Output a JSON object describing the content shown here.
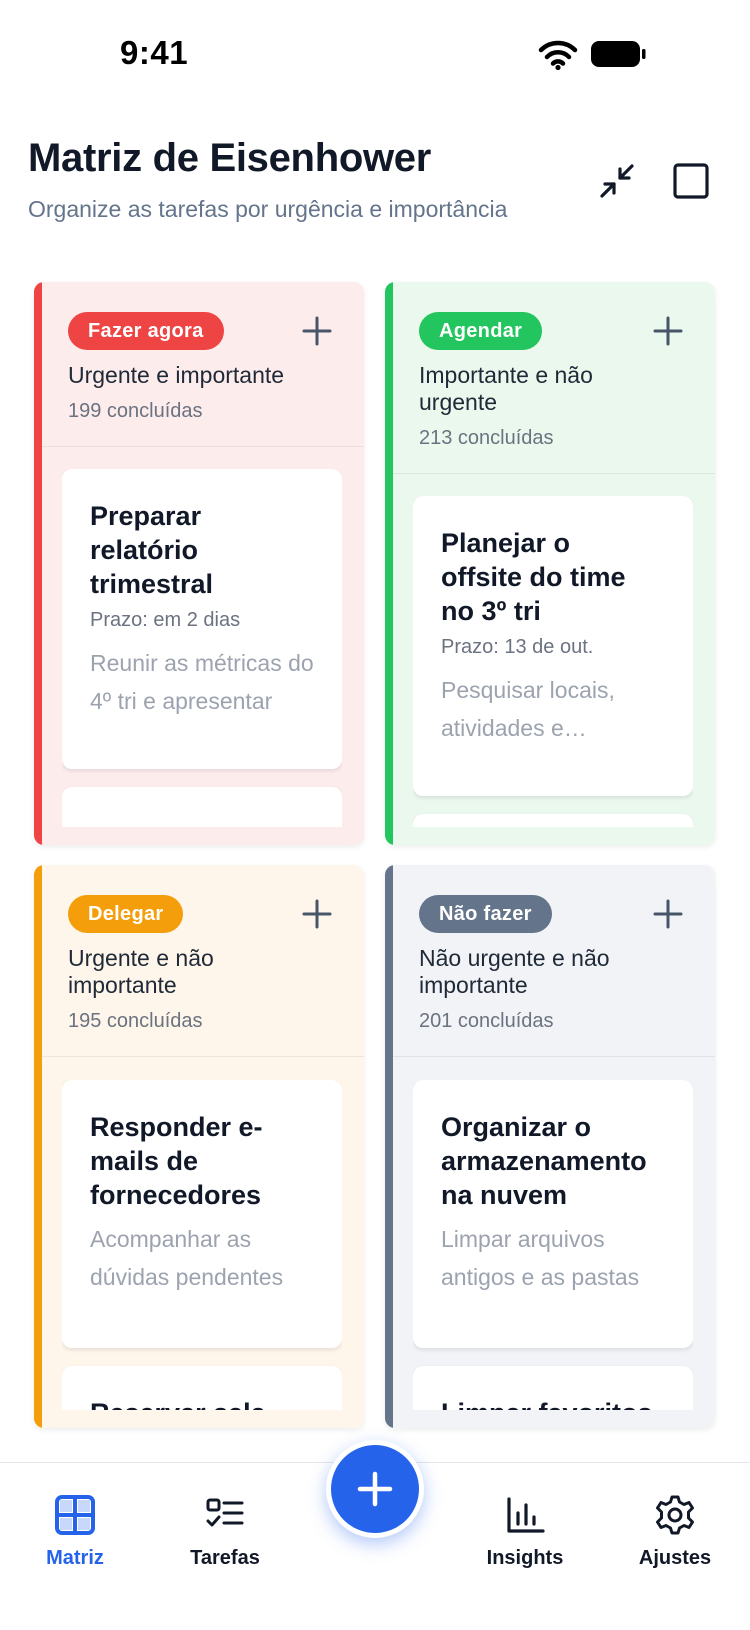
{
  "status_bar": {
    "time": "9:41"
  },
  "header": {
    "title": "Matriz de Eisenhower",
    "subtitle": "Organize as tarefas por urgência e importância"
  },
  "colors": {
    "do_now": "#ef4444",
    "schedule": "#22c55e",
    "delegate": "#f59e0b",
    "dont_do": "#64748b",
    "primary": "#2563eb"
  },
  "quadrants": [
    {
      "badge": "Fazer agora",
      "label": "Urgente e importante",
      "count": "199 concluídas",
      "cards": [
        {
          "title": "Preparar relatório trimestral",
          "due": "Prazo: em 2 dias",
          "desc": "Reunir as métricas do 4º tri e apresentar"
        }
      ]
    },
    {
      "badge": "Agendar",
      "label": "Importante e não urgente",
      "count": "213 concluídas",
      "cards": [
        {
          "title": "Planejar o offsite do time no 3º tri",
          "due": "Prazo: 13 de out.",
          "desc": "Pesquisar locais, atividades e orçamento"
        }
      ]
    },
    {
      "badge": "Delegar",
      "label": "Urgente e não importante",
      "count": "195 concluídas",
      "cards": [
        {
          "title": "Responder e-mails de fornecedores",
          "desc": "Acompanhar as dúvidas pendentes"
        },
        {
          "title": "Reservar sala"
        }
      ]
    },
    {
      "badge": "Não fazer",
      "label": "Não urgente e não importante",
      "count": "201 concluídas",
      "cards": [
        {
          "title": "Organizar o armazenamento na nuvem",
          "desc": "Limpar arquivos antigos e as pastas"
        },
        {
          "title": "Limpar favoritos"
        }
      ]
    }
  ],
  "nav": {
    "matriz": "Matriz",
    "tarefas": "Tarefas",
    "insights": "Insights",
    "ajustes": "Ajustes"
  }
}
